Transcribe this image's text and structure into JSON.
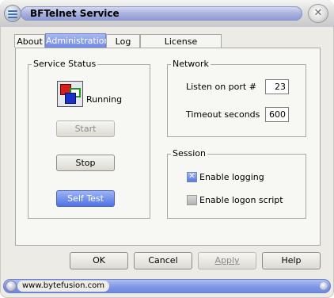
{
  "window": {
    "title": "BFTelnet Service",
    "close_symbol": "✕"
  },
  "tabs": [
    {
      "label": "About",
      "active": false
    },
    {
      "label": "Administration",
      "active": true
    },
    {
      "label": "Log",
      "active": false
    },
    {
      "label": "License Agreement",
      "active": false
    }
  ],
  "service_status": {
    "legend": "Service Status",
    "status_text": "Running",
    "start_label": "Start",
    "stop_label": "Stop",
    "self_test_label": "Self Test"
  },
  "network": {
    "legend": "Network",
    "port_label": "Listen on port #",
    "port_value": "23",
    "timeout_label": "Timeout seconds",
    "timeout_value": "600"
  },
  "session": {
    "legend": "Session",
    "enable_logging_label": "Enable logging",
    "enable_logging_checked": true,
    "enable_logon_script_label": "Enable logon script",
    "enable_logon_script_checked": false
  },
  "dialog_buttons": {
    "ok": "OK",
    "cancel": "Cancel",
    "apply": "Apply",
    "help": "Help"
  },
  "status_bar": {
    "url": "www.bytefusion.com"
  },
  "colors": {
    "accent_blue": "#6d86e6",
    "window_bg": "#ecebe6"
  }
}
